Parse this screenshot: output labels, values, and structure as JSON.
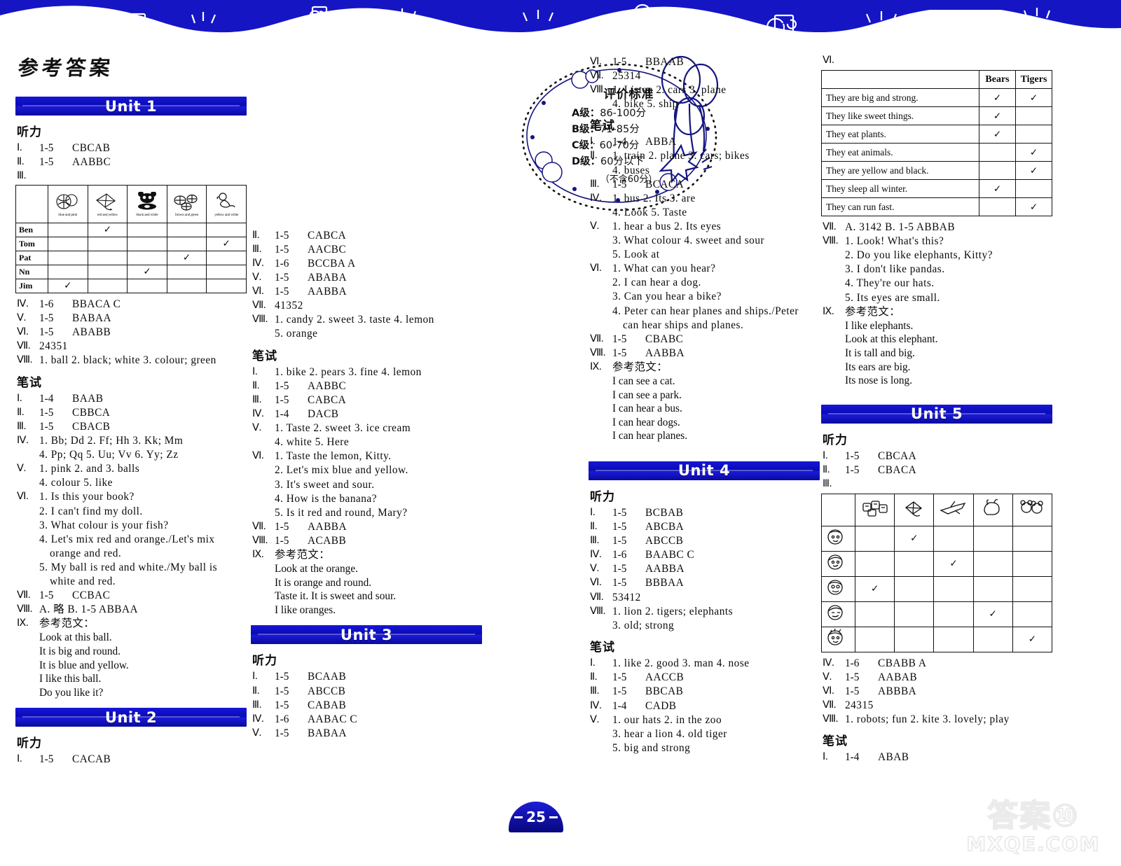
{
  "page": {
    "title": "参考答案",
    "page_number": "25",
    "watermark_line1": "答案⑩",
    "watermark_line2": "MXQE.COM",
    "listening_label": "听力",
    "written_label": "笔试",
    "reference_essay_label": "参考范文："
  },
  "eval_box": {
    "title": "评价标准",
    "levels": [
      {
        "grade": "A级：",
        "range": "86-100分"
      },
      {
        "grade": "B级：",
        "range": "71-85分"
      },
      {
        "grade": "C级：",
        "range": "60-70分"
      },
      {
        "grade": "D级：",
        "range": "60分以下"
      }
    ],
    "footnote": "（不含60分）"
  },
  "units": {
    "unit1": {
      "label": "Unit 1"
    },
    "unit2": {
      "label": "Unit 2"
    },
    "unit3": {
      "label": "Unit 3"
    },
    "unit4": {
      "label": "Unit 4"
    },
    "unit5": {
      "label": "Unit 5"
    }
  },
  "col1": {
    "u1_listening": [
      {
        "n": "Ⅰ.",
        "range": "1-5",
        "ans": "CBCAB"
      },
      {
        "n": "Ⅱ.",
        "range": "1-5",
        "ans": "AABBC"
      },
      {
        "n": "Ⅲ.",
        "range": "",
        "ans": ""
      }
    ],
    "u1_table": {
      "col_captions": [
        "blue and pink",
        "red and yellow",
        "black and white",
        "brown and green",
        "yellow and white"
      ],
      "rows": [
        {
          "name": "Ben",
          "check": 1
        },
        {
          "name": "Tom",
          "check": 4
        },
        {
          "name": "Pat",
          "check": 3
        },
        {
          "name": "Nn",
          "check": 2
        },
        {
          "name": "Jim",
          "check": 0
        }
      ]
    },
    "u1_listening2": [
      {
        "n": "Ⅳ.",
        "range": "1-6",
        "ans": "BBACA C"
      },
      {
        "n": "Ⅴ.",
        "range": "1-5",
        "ans": "BABAA"
      },
      {
        "n": "Ⅵ.",
        "range": "1-5",
        "ans": "ABABB"
      },
      {
        "n": "Ⅶ.",
        "range": "",
        "ans": "24351"
      },
      {
        "n": "Ⅷ.",
        "range": "",
        "ans": "1. ball   2. black; white   3. colour; green"
      }
    ],
    "u1_written": [
      {
        "n": "Ⅰ.",
        "range": "1-4",
        "ans": "BAAB"
      },
      {
        "n": "Ⅱ.",
        "range": "1-5",
        "ans": "CBBCA"
      },
      {
        "n": "Ⅲ.",
        "range": "1-5",
        "ans": "CBACB"
      },
      {
        "n": "Ⅳ.",
        "range": "",
        "ans": "1. Bb; Dd   2. Ff; Hh   3. Kk; Mm"
      },
      {
        "n": "",
        "range": "",
        "ans": "4. Pp; Qq   5. Uu; Vv   6. Yy; Zz"
      },
      {
        "n": "Ⅴ.",
        "range": "",
        "ans": "1. pink   2. and   3. balls"
      },
      {
        "n": "",
        "range": "",
        "ans": "4. colour   5. like"
      },
      {
        "n": "Ⅵ.",
        "range": "",
        "ans": "1. Is this your book?"
      },
      {
        "n": "",
        "range": "",
        "ans": "2. I can't find my doll."
      },
      {
        "n": "",
        "range": "",
        "ans": "3. What colour is your fish?"
      },
      {
        "n": "",
        "range": "",
        "ans": "4. Let's mix red and orange./Let's mix"
      },
      {
        "n": "",
        "range": "",
        "ans": "orange and red.",
        "indent": true
      },
      {
        "n": "",
        "range": "",
        "ans": "5. My ball is red and white./My ball is"
      },
      {
        "n": "",
        "range": "",
        "ans": "white and red.",
        "indent": true
      },
      {
        "n": "Ⅶ.",
        "range": "1-5",
        "ans": "CCBAC"
      },
      {
        "n": "Ⅷ.",
        "range": "",
        "ans": "A. 略        B. 1-5   ABBAA"
      },
      {
        "n": "Ⅸ.",
        "range": "",
        "ans": "参考范文："
      }
    ],
    "u1_essay": [
      "Look at this ball.",
      "It is big and round.",
      "It is blue and yellow.",
      "I like this ball.",
      "Do you like it?"
    ],
    "u2_listening": [
      {
        "n": "Ⅰ.",
        "range": "1-5",
        "ans": "CACAB"
      }
    ]
  },
  "col2": {
    "u2_listening_cont": [
      {
        "n": "Ⅱ.",
        "range": "1-5",
        "ans": "CABCA"
      },
      {
        "n": "Ⅲ.",
        "range": "1-5",
        "ans": "AACBC"
      },
      {
        "n": "Ⅳ.",
        "range": "1-6",
        "ans": "BCCBA A"
      },
      {
        "n": "Ⅴ.",
        "range": "1-5",
        "ans": "ABABA"
      },
      {
        "n": "Ⅵ.",
        "range": "1-5",
        "ans": "AABBA"
      },
      {
        "n": "Ⅶ.",
        "range": "",
        "ans": "41352"
      },
      {
        "n": "Ⅷ.",
        "range": "",
        "ans": "1. candy   2. sweet   3. taste   4. lemon"
      },
      {
        "n": "",
        "range": "",
        "ans": "5. orange"
      }
    ],
    "u2_written": [
      {
        "n": "Ⅰ.",
        "range": "",
        "ans": "1. bike   2. pears   3. fine   4. lemon"
      },
      {
        "n": "Ⅱ.",
        "range": "1-5",
        "ans": "AABBC"
      },
      {
        "n": "Ⅲ.",
        "range": "1-5",
        "ans": "CABCA"
      },
      {
        "n": "Ⅳ.",
        "range": "1-4",
        "ans": "DACB"
      },
      {
        "n": "Ⅴ.",
        "range": "",
        "ans": "1. Taste   2. sweet   3. ice cream"
      },
      {
        "n": "",
        "range": "",
        "ans": "4. white   5. Here"
      },
      {
        "n": "Ⅵ.",
        "range": "",
        "ans": "1. Taste the lemon, Kitty."
      },
      {
        "n": "",
        "range": "",
        "ans": "2. Let's mix blue and yellow."
      },
      {
        "n": "",
        "range": "",
        "ans": "3. It's sweet and sour."
      },
      {
        "n": "",
        "range": "",
        "ans": "4. How is the banana?"
      },
      {
        "n": "",
        "range": "",
        "ans": "5. Is it red and round, Mary?"
      },
      {
        "n": "Ⅶ.",
        "range": "1-5",
        "ans": "AABBA"
      },
      {
        "n": "Ⅷ.",
        "range": "1-5",
        "ans": "ACABB"
      },
      {
        "n": "Ⅸ.",
        "range": "",
        "ans": "参考范文："
      }
    ],
    "u2_essay": [
      "Look at the orange.",
      "It is orange and round.",
      "Taste it. It is sweet and sour.",
      "I like oranges."
    ],
    "u3_listening": [
      {
        "n": "Ⅰ.",
        "range": "1-5",
        "ans": "BCAAB"
      },
      {
        "n": "Ⅱ.",
        "range": "1-5",
        "ans": "ABCCB"
      },
      {
        "n": "Ⅲ.",
        "range": "1-5",
        "ans": "CABAB"
      },
      {
        "n": "Ⅳ.",
        "range": "1-6",
        "ans": "AABAC C"
      },
      {
        "n": "Ⅴ.",
        "range": "1-5",
        "ans": "BABAA"
      }
    ]
  },
  "col3": {
    "u3_listening_cont": [
      {
        "n": "Ⅵ.",
        "range": "1-5",
        "ans": "BBAAB"
      },
      {
        "n": "Ⅶ.",
        "range": "",
        "ans": "25314"
      },
      {
        "n": "Ⅷ.",
        "range": "",
        "ans": "1. Listen   2. cars   3. plane"
      },
      {
        "n": "",
        "range": "",
        "ans": "4. bike   5. ship"
      }
    ],
    "u3_written": [
      {
        "n": "Ⅰ.",
        "range": "1-4",
        "ans": "ABBA"
      },
      {
        "n": "Ⅱ.",
        "range": "",
        "ans": "1. train   2. plane   3. cars; bikes"
      },
      {
        "n": "",
        "range": "",
        "ans": "4. buses"
      },
      {
        "n": "Ⅲ.",
        "range": "1-5",
        "ans": "BCACA"
      },
      {
        "n": "Ⅳ.",
        "range": "",
        "ans": "1. bus   2. Its   3. are"
      },
      {
        "n": "",
        "range": "",
        "ans": "4. Look   5. Taste"
      },
      {
        "n": "Ⅴ.",
        "range": "",
        "ans": "1. hear a bus   2. Its eyes"
      },
      {
        "n": "",
        "range": "",
        "ans": "3. What colour   4. sweet and sour"
      },
      {
        "n": "",
        "range": "",
        "ans": "5. Look at"
      },
      {
        "n": "Ⅵ.",
        "range": "",
        "ans": "1. What can you hear?"
      },
      {
        "n": "",
        "range": "",
        "ans": "2. I can hear a dog."
      },
      {
        "n": "",
        "range": "",
        "ans": "3. Can you hear a bike?"
      },
      {
        "n": "",
        "range": "",
        "ans": "4. Peter can hear planes and ships./Peter"
      },
      {
        "n": "",
        "range": "",
        "ans": "can hear ships and planes.",
        "indent": true
      },
      {
        "n": "Ⅶ.",
        "range": "1-5",
        "ans": "CBABC"
      },
      {
        "n": "Ⅷ.",
        "range": "1-5",
        "ans": "AABBA"
      },
      {
        "n": "Ⅸ.",
        "range": "",
        "ans": "参考范文："
      }
    ],
    "u3_essay": [
      "I can see a cat.",
      "I can see a park.",
      "I can hear a bus.",
      "I can hear dogs.",
      "I can hear planes."
    ],
    "u4_listening": [
      {
        "n": "Ⅰ.",
        "range": "1-5",
        "ans": "BCBAB"
      },
      {
        "n": "Ⅱ.",
        "range": "1-5",
        "ans": "ABCBA"
      },
      {
        "n": "Ⅲ.",
        "range": "1-5",
        "ans": "ABCCB"
      },
      {
        "n": "Ⅳ.",
        "range": "1-6",
        "ans": "BAABC C"
      },
      {
        "n": "Ⅴ.",
        "range": "1-5",
        "ans": "AABBA"
      },
      {
        "n": "Ⅵ.",
        "range": "1-5",
        "ans": "BBBAA"
      },
      {
        "n": "Ⅶ.",
        "range": "",
        "ans": "53412"
      },
      {
        "n": "Ⅷ.",
        "range": "",
        "ans": "1. lion   2. tigers; elephants"
      },
      {
        "n": "",
        "range": "",
        "ans": "3. old; strong"
      }
    ],
    "u4_written": [
      {
        "n": "Ⅰ.",
        "range": "",
        "ans": "1. like   2. good   3. man   4. nose"
      },
      {
        "n": "Ⅱ.",
        "range": "1-5",
        "ans": "AACCB"
      },
      {
        "n": "Ⅲ.",
        "range": "1-5",
        "ans": "BBCAB"
      },
      {
        "n": "Ⅳ.",
        "range": "1-4",
        "ans": "CADB"
      },
      {
        "n": "Ⅴ.",
        "range": "",
        "ans": "1. our hats   2. in the zoo"
      },
      {
        "n": "",
        "range": "",
        "ans": "3. hear a lion   4. old tiger"
      },
      {
        "n": "",
        "range": "",
        "ans": "5. big and strong"
      }
    ]
  },
  "col4": {
    "u4_written_cont_label": "Ⅵ.",
    "bears_tigers_table": {
      "headers": [
        "",
        "Bears",
        "Tigers"
      ],
      "rows": [
        {
          "statement": "They are big and strong.",
          "bears": true,
          "tigers": true
        },
        {
          "statement": "They like sweet things.",
          "bears": true,
          "tigers": false
        },
        {
          "statement": "They eat plants.",
          "bears": true,
          "tigers": false
        },
        {
          "statement": "They eat animals.",
          "bears": false,
          "tigers": true
        },
        {
          "statement": "They are yellow and black.",
          "bears": false,
          "tigers": true
        },
        {
          "statement": "They sleep all winter.",
          "bears": true,
          "tigers": false
        },
        {
          "statement": "They can run fast.",
          "bears": false,
          "tigers": true
        }
      ]
    },
    "u4_written_cont": [
      {
        "n": "Ⅶ.",
        "range": "",
        "ans": "A. 3142        B. 1-5   ABBAB"
      },
      {
        "n": "Ⅷ.",
        "range": "",
        "ans": "1. Look! What's this?"
      },
      {
        "n": "",
        "range": "",
        "ans": "2. Do you like elephants, Kitty?"
      },
      {
        "n": "",
        "range": "",
        "ans": "3. I don't like pandas."
      },
      {
        "n": "",
        "range": "",
        "ans": "4. They're our hats."
      },
      {
        "n": "",
        "range": "",
        "ans": "5. Its eyes are small."
      },
      {
        "n": "Ⅸ.",
        "range": "",
        "ans": "参考范文："
      }
    ],
    "u4_essay": [
      "I like elephants.",
      "Look at this elephant.",
      "It is tall and big.",
      "Its ears are big.",
      "Its nose is long."
    ],
    "u5_listening": [
      {
        "n": "Ⅰ.",
        "range": "1-5",
        "ans": "CBCAA"
      },
      {
        "n": "Ⅱ.",
        "range": "1-5",
        "ans": "CBACA"
      },
      {
        "n": "Ⅲ.",
        "range": "",
        "ans": ""
      }
    ],
    "u5_table": {
      "rows": [
        {
          "check": 1
        },
        {
          "check": 2
        },
        {
          "check": 0
        },
        {
          "check": 3
        },
        {
          "check": 4
        }
      ]
    },
    "u5_listening2": [
      {
        "n": "Ⅳ.",
        "range": "1-6",
        "ans": "CBABB A"
      },
      {
        "n": "Ⅴ.",
        "range": "1-5",
        "ans": "AABAB"
      },
      {
        "n": "Ⅵ.",
        "range": "1-5",
        "ans": "ABBBA"
      },
      {
        "n": "Ⅶ.",
        "range": "",
        "ans": "24315"
      },
      {
        "n": "Ⅷ.",
        "range": "",
        "ans": "1. robots; fun   2. kite   3. lovely; play"
      }
    ],
    "u5_written": [
      {
        "n": "Ⅰ.",
        "range": "1-4",
        "ans": "ABAB"
      }
    ]
  }
}
